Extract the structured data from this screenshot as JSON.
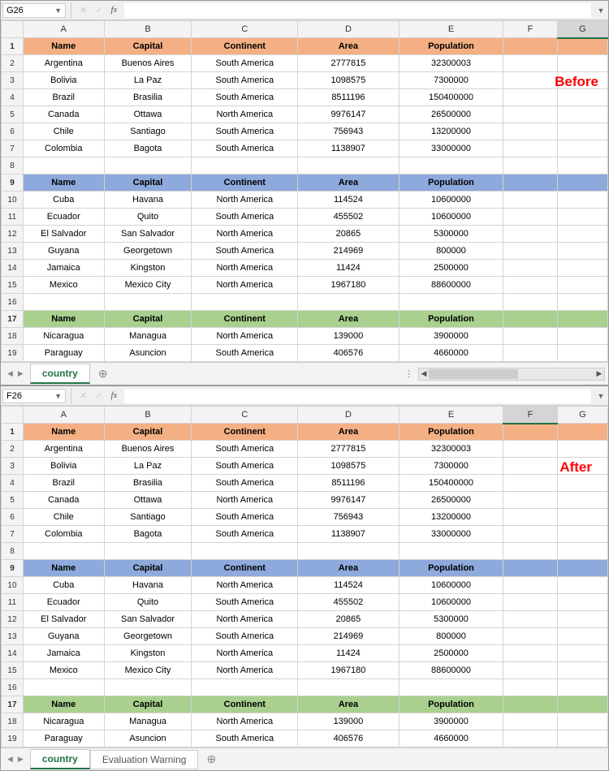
{
  "before": {
    "cell_ref": "G26",
    "annot": "Before",
    "columns": [
      "A",
      "B",
      "C",
      "D",
      "E",
      "F",
      "G"
    ],
    "selected_col": "G",
    "rows": [
      "1",
      "2",
      "3",
      "4",
      "5",
      "6",
      "7",
      "8",
      "9",
      "10",
      "11",
      "12",
      "13",
      "14",
      "15",
      "16",
      "17",
      "18",
      "19"
    ],
    "tab": "country"
  },
  "after": {
    "cell_ref": "F26",
    "annot": "After",
    "columns": [
      "A",
      "B",
      "C",
      "D",
      "E",
      "F",
      "G"
    ],
    "selected_col": "F",
    "rows": [
      "1",
      "2",
      "3",
      "4",
      "5",
      "6",
      "7",
      "8",
      "9",
      "10",
      "11",
      "12",
      "13",
      "14",
      "15",
      "16",
      "17",
      "18",
      "19"
    ],
    "tab1": "country",
    "tab2": "Evaluation Warning"
  },
  "headers": {
    "name": "Name",
    "capital": "Capital",
    "continent": "Continent",
    "area": "Area",
    "population": "Population"
  },
  "data1": [
    {
      "name": "Argentina",
      "capital": "Buenos Aires",
      "continent": "South America",
      "area": "2777815",
      "population": "32300003"
    },
    {
      "name": "Bolivia",
      "capital": "La Paz",
      "continent": "South America",
      "area": "1098575",
      "population": "7300000"
    },
    {
      "name": "Brazil",
      "capital": "Brasilia",
      "continent": "South America",
      "area": "8511196",
      "population": "150400000"
    },
    {
      "name": "Canada",
      "capital": "Ottawa",
      "continent": "North America",
      "area": "9976147",
      "population": "26500000"
    },
    {
      "name": "Chile",
      "capital": "Santiago",
      "continent": "South America",
      "area": "756943",
      "population": "13200000"
    },
    {
      "name": "Colombia",
      "capital": "Bagota",
      "continent": "South America",
      "area": "1138907",
      "population": "33000000"
    }
  ],
  "data2": [
    {
      "name": "Cuba",
      "capital": "Havana",
      "continent": "North America",
      "area": "114524",
      "population": "10600000"
    },
    {
      "name": "Ecuador",
      "capital": "Quito",
      "continent": "South America",
      "area": "455502",
      "population": "10600000"
    },
    {
      "name": "El Salvador",
      "capital": "San Salvador",
      "continent": "North America",
      "area": "20865",
      "population": "5300000"
    },
    {
      "name": "Guyana",
      "capital": "Georgetown",
      "continent": "South America",
      "area": "214969",
      "population": "800000"
    },
    {
      "name": "Jamaica",
      "capital": "Kingston",
      "continent": "North America",
      "area": "11424",
      "population": "2500000"
    },
    {
      "name": "Mexico",
      "capital": "Mexico City",
      "continent": "North America",
      "area": "1967180",
      "population": "88600000"
    }
  ],
  "data3": [
    {
      "name": "Nicaragua",
      "capital": "Managua",
      "continent": "North America",
      "area": "139000",
      "population": "3900000"
    },
    {
      "name": "Paraguay",
      "capital": "Asuncion",
      "continent": "South America",
      "area": "406576",
      "population": "4660000"
    }
  ]
}
